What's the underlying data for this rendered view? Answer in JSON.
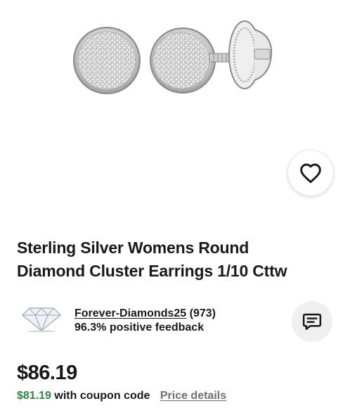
{
  "product": {
    "title_line1": "Sterling Silver Womens Round",
    "title_line2": "Diamond Cluster Earrings 1/10 Cttw"
  },
  "seller": {
    "name": "Forever-Diamonds25",
    "rating_count": "(973)",
    "feedback": "96.3% positive feedback"
  },
  "pricing": {
    "price": "$86.19",
    "coupon_price": "$81.19",
    "coupon_text": "with coupon code",
    "details_link": "Price details"
  },
  "icons": {
    "favorite": "heart-icon",
    "message": "message-icon",
    "seller_logo": "diamond-icon"
  },
  "colors": {
    "coupon_green": "#2a8a3e",
    "link_gray": "#707070",
    "text": "#191919"
  }
}
